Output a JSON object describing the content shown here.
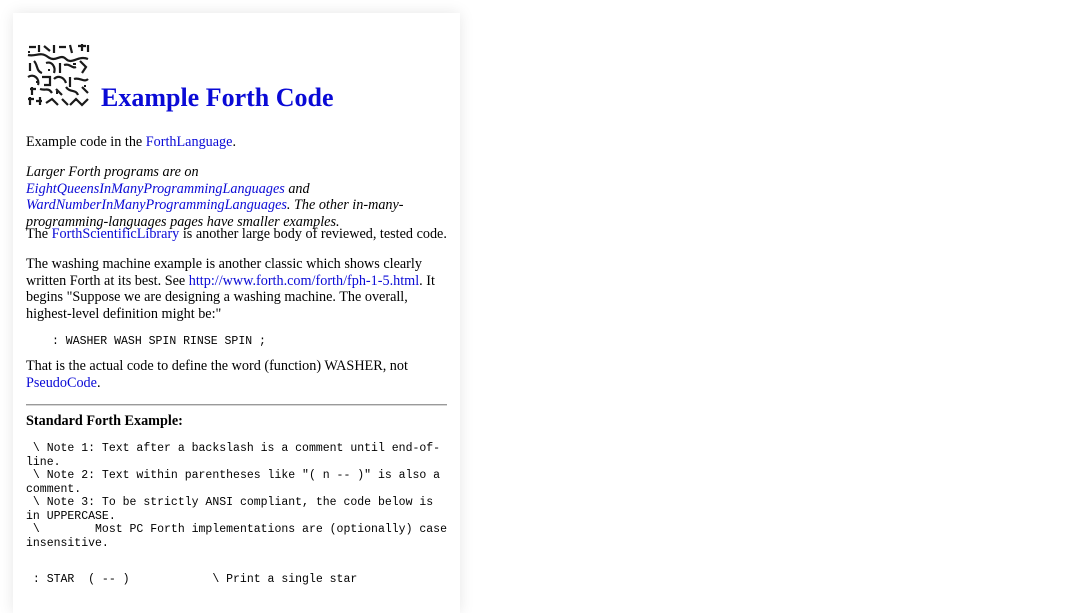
{
  "title": "Example Forth Code",
  "intro": {
    "before": "Example code in the ",
    "link": "ForthLanguage",
    "after": "."
  },
  "larger": {
    "before": "Larger Forth programs are on ",
    "link1": "EightQueensInManyProgrammingLanguages",
    "mid": " and ",
    "link2": "WardNumberInManyProgrammingLanguages",
    "after": ". The other in-many-programming-languages pages have smaller examples."
  },
  "library": {
    "before": "The ",
    "link": "ForthScientificLibrary",
    "after": " is another large body of reviewed, tested code."
  },
  "washing": {
    "before": "The washing machine example is another classic which shows clearly written Forth at its best. See ",
    "link": "http://www.forth.com/forth/fph-1-5.html",
    "after": ". It begins \"Suppose we are designing a washing machine. The overall, highest-level definition might be:\""
  },
  "washer_code": ": WASHER WASH SPIN RINSE SPIN ;",
  "actual": {
    "before": "That is the actual code to define the word (function) WASHER, not ",
    "link": "PseudoCode",
    "after": "."
  },
  "standard_heading": "Standard Forth Example:",
  "notes_code": " \\ Note 1: Text after a backslash is a comment until end-of-line.\n \\ Note 2: Text within parentheses like \"( n -- )\" is also a comment.\n \\ Note 3: To be strictly ANSI compliant, the code below is in UPPERCASE.\n \\        Most PC Forth implementations are (optionally) case insensitive.",
  "star_code": " : STAR  ( -- )            \\ Print a single star"
}
